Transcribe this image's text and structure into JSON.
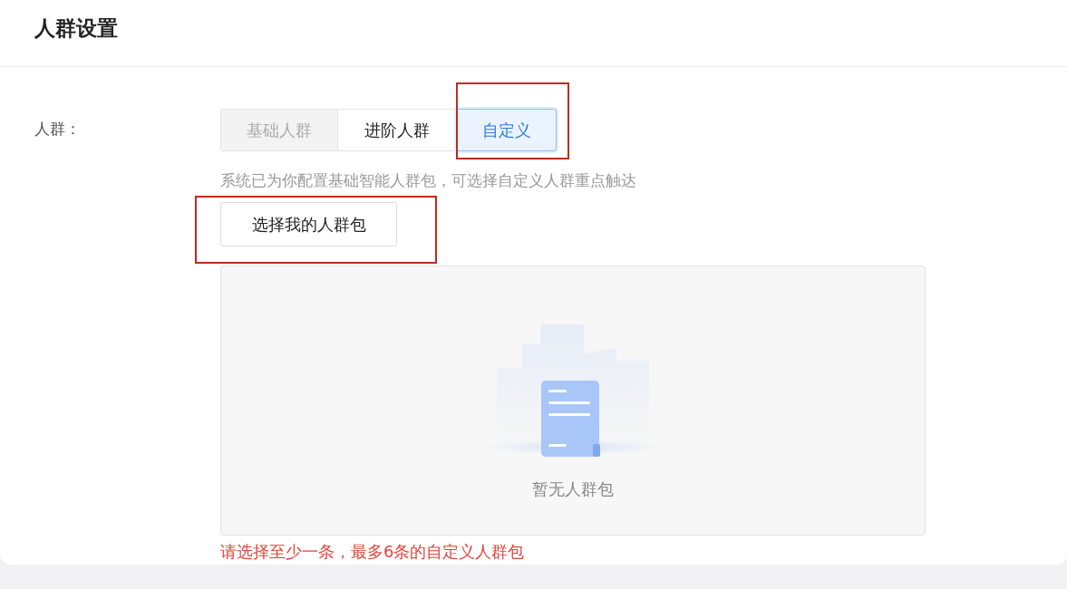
{
  "header": {
    "title": "人群设置"
  },
  "field": {
    "label": "人群："
  },
  "segments": [
    {
      "label": "基础人群",
      "selected": false,
      "disabled": true,
      "highlighted": false
    },
    {
      "label": "进阶人群",
      "selected": false,
      "disabled": false,
      "highlighted": false
    },
    {
      "label": "自定义",
      "selected": true,
      "disabled": false,
      "highlighted": true
    }
  ],
  "hint": "系统已为你配置基础智能人群包，可选择自定义人群重点触达",
  "select_button": {
    "label": "选择我的人群包",
    "highlighted": true
  },
  "empty_state": {
    "message": "暂无人群包"
  },
  "error": "请选择至少一条，最多6条的自定义人群包"
}
